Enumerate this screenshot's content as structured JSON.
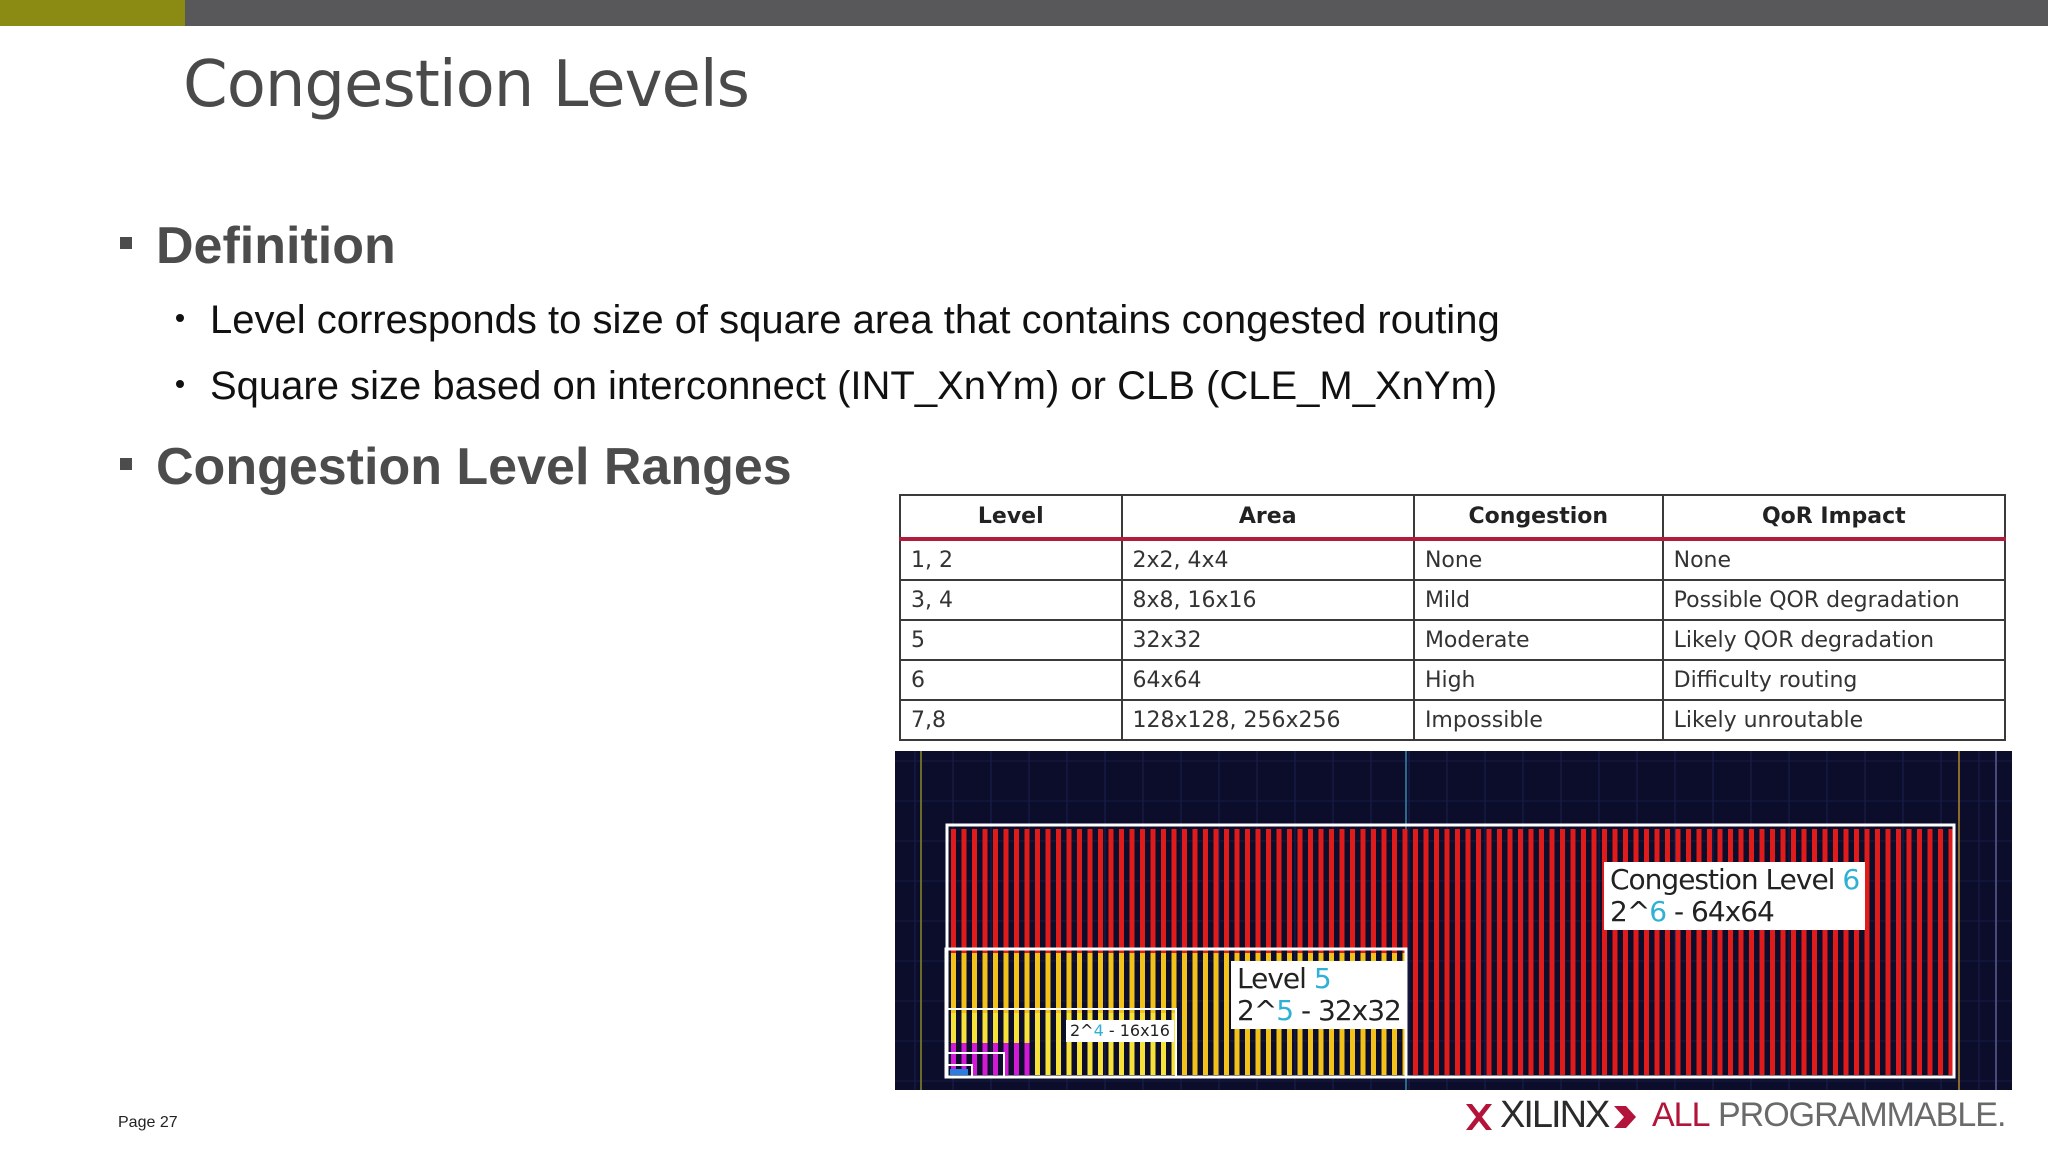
{
  "title": "Congestion Levels",
  "section1": {
    "heading": "Definition",
    "bullets": [
      "Level corresponds to size of square area that contains congested routing",
      "Square size based on interconnect (INT_XnYm) or CLB (CLE_M_XnYm)"
    ]
  },
  "section2": {
    "heading": "Congestion Level Ranges"
  },
  "table": {
    "headers": [
      "Level",
      "Area",
      "Congestion",
      "QoR Impact"
    ],
    "rows": [
      [
        "1, 2",
        "2x2, 4x4",
        "None",
        "None"
      ],
      [
        "3, 4",
        "8x8, 16x16",
        "Mild",
        "Possible QOR degradation"
      ],
      [
        "5",
        "32x32",
        "Moderate",
        "Likely QOR degradation"
      ],
      [
        "6",
        "64x64",
        "High",
        "Difficulty routing"
      ],
      [
        "7,8",
        "128x128, 256x256",
        "Impossible",
        "Likely unroutable"
      ]
    ]
  },
  "image_labels": {
    "level6_title": "Congestion Level ",
    "level6_num": "6",
    "level6_pre": "2^",
    "level6_exp": "6",
    "level6_suffix": " - 64x64",
    "level5_title": "Level ",
    "level5_num": "5",
    "level5_pre": "2^",
    "level5_exp": "5",
    "level5_suffix": " - 32x32",
    "level4_pre": "2^",
    "level4_exp": "4",
    "level4_suffix": " - 16x16"
  },
  "footer": {
    "page": "Page 27",
    "logo_brand": "XILINX",
    "logo_all": "ALL",
    "logo_programmable": "PROGRAMMABLE."
  },
  "colors": {
    "accent_bar": "#8b8b14",
    "top_bar": "#58585a",
    "table_header_rule": "#b11c3c",
    "brand_red": "#b2143a",
    "level_number": "#2fb0d5"
  }
}
